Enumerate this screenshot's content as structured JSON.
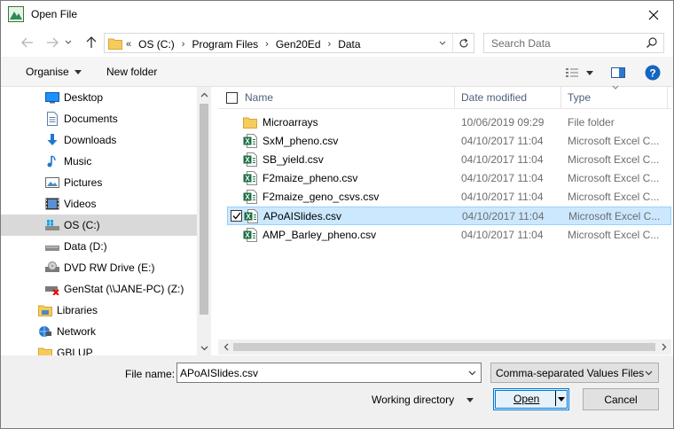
{
  "window": {
    "title": "Open File"
  },
  "address": {
    "lead": "«",
    "crumbs": [
      "OS (C:)",
      "Program Files",
      "Gen20Ed",
      "Data"
    ],
    "separator": "›"
  },
  "search": {
    "placeholder": "Search Data"
  },
  "toolbar": {
    "organise_label": "Organise",
    "new_folder_label": "New folder"
  },
  "nav": {
    "items": [
      {
        "label": "Desktop",
        "icon": "desktop-icon"
      },
      {
        "label": "Documents",
        "icon": "documents-icon"
      },
      {
        "label": "Downloads",
        "icon": "downloads-icon"
      },
      {
        "label": "Music",
        "icon": "music-icon"
      },
      {
        "label": "Pictures",
        "icon": "pictures-icon"
      },
      {
        "label": "Videos",
        "icon": "videos-icon"
      },
      {
        "label": "OS (C:)",
        "icon": "drive-icon"
      },
      {
        "label": "Data (D:)",
        "icon": "drive-icon"
      },
      {
        "label": "DVD RW Drive (E:)",
        "icon": "dvd-drive-icon"
      },
      {
        "label": "GenStat (\\\\JANE-PC) (Z:)",
        "icon": "network-drive-disconnected-icon"
      },
      {
        "label": "Libraries",
        "icon": "libraries-icon"
      },
      {
        "label": "Network",
        "icon": "network-icon"
      },
      {
        "label": "GBLUP",
        "icon": "folder-icon"
      }
    ],
    "selected_index": 6
  },
  "columns": {
    "name": "Name",
    "date_modified": "Date modified",
    "type": "Type"
  },
  "files": [
    {
      "name": "Microarrays",
      "date": "10/06/2019 09:29",
      "type": "File folder",
      "icon": "folder-icon"
    },
    {
      "name": "SxM_pheno.csv",
      "date": "04/10/2017 11:04",
      "type": "Microsoft Excel C...",
      "icon": "excel-csv-icon"
    },
    {
      "name": "SB_yield.csv",
      "date": "04/10/2017 11:04",
      "type": "Microsoft Excel C...",
      "icon": "excel-csv-icon"
    },
    {
      "name": "F2maize_pheno.csv",
      "date": "04/10/2017 11:04",
      "type": "Microsoft Excel C...",
      "icon": "excel-csv-icon"
    },
    {
      "name": "F2maize_geno_csvs.csv",
      "date": "04/10/2017 11:04",
      "type": "Microsoft Excel C...",
      "icon": "excel-csv-icon"
    },
    {
      "name": "APoAISlides.csv",
      "date": "04/10/2017 11:04",
      "type": "Microsoft Excel C...",
      "icon": "excel-csv-icon"
    },
    {
      "name": "AMP_Barley_pheno.csv",
      "date": "04/10/2017 11:04",
      "type": "Microsoft Excel C...",
      "icon": "excel-csv-icon"
    }
  ],
  "selected_file_index": 5,
  "bottom": {
    "file_name_label": "File name:",
    "file_name_value": "APoAISlides.csv",
    "file_type_value": "Comma-separated Values Files",
    "working_directory_label": "Working directory",
    "open_label": "Open",
    "cancel_label": "Cancel"
  },
  "colors": {
    "accent": "#0078d7",
    "selection": "#cce8ff",
    "header_text": "#4c607a",
    "folder": "#e8b84a",
    "excel_green": "#1d7044"
  }
}
